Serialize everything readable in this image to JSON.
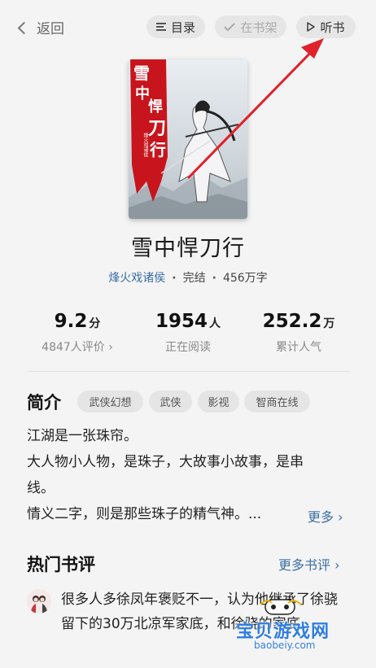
{
  "topbar": {
    "back_label": "返回",
    "toc_label": "目录",
    "shelf_label": "在书架",
    "listen_label": "听书"
  },
  "book": {
    "cover_title_chars": "雪中悍刀行",
    "cover_author_small": "烽火戏诸侯",
    "title": "雪中悍刀行",
    "author": "烽火戏诸侯",
    "status": "完结",
    "words": "456万字"
  },
  "stats": [
    {
      "num": "9.2",
      "unit": "分",
      "label": "4847人评价 ›"
    },
    {
      "num": "1954",
      "unit": "人",
      "label": "正在阅读"
    },
    {
      "num": "252.2",
      "unit": "万",
      "label": "累计人气"
    }
  ],
  "intro": {
    "title": "简介",
    "tags": [
      "武侠幻想",
      "武侠",
      "影视",
      "智商在线"
    ],
    "lines": [
      "江湖是一张珠帘。",
      "大人物小人物，是珠子，大故事小故事，是串线。",
      "情义二字，则是那些珠子的精气神。..."
    ],
    "more_label": "更多 ›"
  },
  "reviews": {
    "title": "热门书评",
    "more_label": "更多书评 ›",
    "first_review": "很多人多徐凤年褒贬不一，认为他继承了徐骁留下的30万北凉军家底，和徐骁的家底"
  },
  "watermark": {
    "text": "宝贝游戏网",
    "url": "baobeiy.com"
  },
  "colors": {
    "accent_link": "#3a6ea5",
    "annotation_arrow": "#e0202a",
    "background": "#f4f4f4"
  }
}
